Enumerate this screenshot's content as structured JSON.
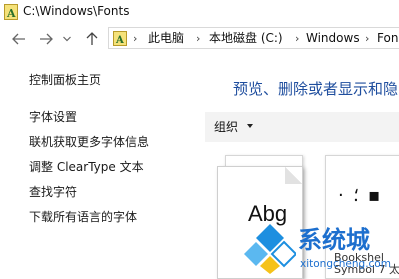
{
  "window": {
    "title": "C:\\Windows\\Fonts"
  },
  "nav": {
    "back_icon": "arrow-left-icon",
    "forward_icon": "arrow-right-icon",
    "recent_icon": "chevron-down-icon",
    "up_icon": "arrow-up-icon"
  },
  "address": {
    "icon": "fonts-folder-icon",
    "crumbs": [
      "此电脑",
      "本地磁盘 (C:)",
      "Windows",
      "Fon"
    ],
    "separator": "›"
  },
  "sidebar": {
    "items": [
      {
        "label": "控制面板主页"
      },
      {
        "label": "字体设置"
      },
      {
        "label": "联机获取更多字体信息"
      },
      {
        "label": "调整 ClearType 文本"
      },
      {
        "label": "查找字符"
      },
      {
        "label": "下载所有语言的字体"
      }
    ]
  },
  "main": {
    "heading": "预览、删除或者显示和隐",
    "toolbar": {
      "organize_label": "组织"
    },
    "tiles": [
      {
        "sample": "Abg"
      },
      {
        "sample": "· ⸵ ▪",
        "name_partial": "Bookshel",
        "name_partial_2": "Symbol 7 太"
      }
    ]
  },
  "watermark": {
    "brand": "系统城",
    "url": "xitongcheng.com"
  },
  "colors": {
    "heading": "#1f4e9e",
    "toolbar_bg": "#f3f3f3",
    "watermark": "#1d6fce"
  }
}
